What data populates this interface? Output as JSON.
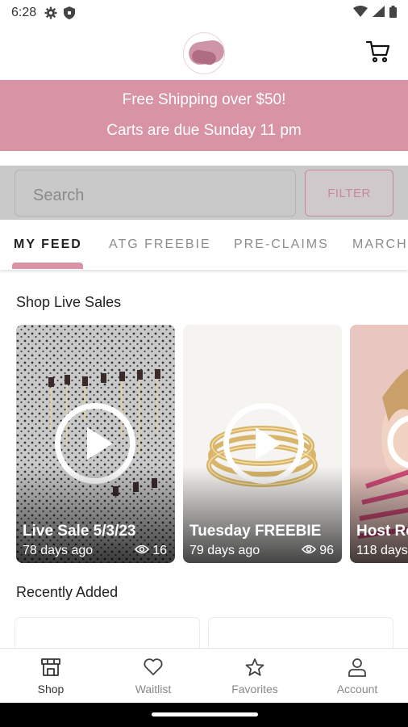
{
  "status_bar": {
    "time": "6:28"
  },
  "banner": {
    "line1": "Free Shipping over $50!",
    "line2": "Carts are due Sunday 11 pm",
    "color": "#d893a5"
  },
  "search": {
    "placeholder": "Search",
    "filter_label": "FILTER"
  },
  "tabs": [
    {
      "label": "MY FEED",
      "active": true
    },
    {
      "label": "ATG FREEBIE",
      "active": false
    },
    {
      "label": "PRE-CLAIMS",
      "active": false
    },
    {
      "label": "MARCH",
      "active": false
    }
  ],
  "live_sales": {
    "heading": "Shop Live Sales",
    "cards": [
      {
        "title": "Live Sale 5/3/23",
        "ago": "78 days ago",
        "views": "16"
      },
      {
        "title": "Tuesday FREEBIE",
        "ago": "79 days ago",
        "views": "96"
      },
      {
        "title": "Host Re",
        "ago": "118 days",
        "views": ""
      }
    ]
  },
  "recently_added": {
    "heading": "Recently Added"
  },
  "bottom_nav": [
    {
      "label": "Shop",
      "icon": "shop-icon",
      "active": true
    },
    {
      "label": "Waitlist",
      "icon": "heart-icon",
      "active": false
    },
    {
      "label": "Favorites",
      "icon": "star-icon",
      "active": false
    },
    {
      "label": "Account",
      "icon": "user-icon",
      "active": false
    }
  ],
  "accent_color": "#d893a5"
}
